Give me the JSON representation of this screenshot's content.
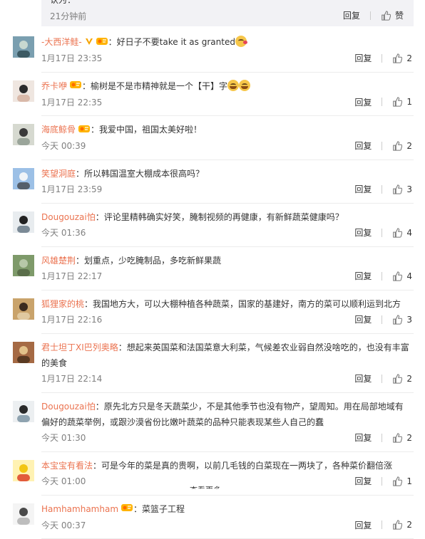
{
  "prev_reply": {
    "text": "认为：",
    "time": "21分钟前",
    "reply_label": "回复",
    "like_label": "赞"
  },
  "colors": {
    "username": "#eb7350",
    "time": "#808080",
    "divider": "#ececec",
    "reply_bg": "#f2f2f5"
  },
  "comments": [
    {
      "user": "-大西洋鲑-",
      "badges": [
        "verified-v-icon",
        "level-badge-icon"
      ],
      "text": "：好日子不要take it as granted",
      "emoji": [
        "kiss"
      ],
      "time": "1月17日 23:35",
      "reply": "回复",
      "likes": "2"
    },
    {
      "user": "乔卡咿",
      "badges": [
        "level-badge-icon"
      ],
      "text": "：榆树是不是市精神就是一个【干】字",
      "emoji": [
        "laugh",
        "laugh"
      ],
      "time": "1月17日 22:35",
      "reply": "回复",
      "likes": "1"
    },
    {
      "user": "海底鲸骨",
      "badges": [
        "level-badge-icon"
      ],
      "text": "：我爱中国，祖国太美好啦！",
      "emoji": [],
      "time": "今天 00:39",
      "reply": "回复",
      "likes": "2"
    },
    {
      "user": "笑望洞庭",
      "badges": [],
      "text": "：所以韩国温室大棚成本很高吗？",
      "emoji": [],
      "time": "1月17日 23:59",
      "reply": "回复",
      "likes": "3"
    },
    {
      "user": "Dougouzai怕",
      "badges": [],
      "text": "：评论里精韩确实好笑，腌制视频的再健康，有新鲜蔬菜健康吗？",
      "emoji": [],
      "time": "今天 01:36",
      "reply": "回复",
      "likes": "4"
    },
    {
      "user": "风雄楚荆",
      "badges": [],
      "text": "：划重点，少吃腌制品，多吃新鲜果蔬",
      "emoji": [],
      "time": "1月17日 22:17",
      "reply": "回复",
      "likes": "4"
    },
    {
      "user": "狐狸家的桃",
      "badges": [],
      "text": "：我国地方大，可以大棚种植各种蔬菜，国家的基建好，南方的菜可以顺利运到北方",
      "emoji": [],
      "time": "1月17日 22:16",
      "reply": "回复",
      "likes": "3"
    },
    {
      "user": "君士坦丁XI巴列奥略",
      "badges": [],
      "text": "：想起来英国菜和法国菜意大利菜，气候差农业弱自然没啥吃的，也没有丰富的美食",
      "emoji": [],
      "time": "1月17日 22:14",
      "reply": "回复",
      "likes": "2"
    },
    {
      "user": "Dougouzai怕",
      "badges": [],
      "text": "：原先北方只是冬天蔬菜少，不是其他季节也没有物产，望周知。用在局部地域有偏好的蔬菜举例，或跟沙漠省份比嫩叶蔬菜的品种只能表现某些人自己的蠢",
      "emoji": [],
      "time": "今天 01:30",
      "reply": "回复",
      "likes": "2"
    },
    {
      "user": "本宝宝有看法",
      "badges": [],
      "text": "：可是今年的菜是真的贵啊，以前几毛钱的白菜现在一两块了，各种菜价翻倍涨",
      "emoji": [],
      "time": "今天 01:00",
      "reply": "回复",
      "likes": "1"
    },
    {
      "user": "Hamhamhamham",
      "badges": [
        "level-badge-icon"
      ],
      "text": "：菜篮子工程",
      "emoji": [],
      "time": "今天 00:37",
      "reply": "回复",
      "likes": "2"
    }
  ],
  "bottom_partial": "查看更多"
}
